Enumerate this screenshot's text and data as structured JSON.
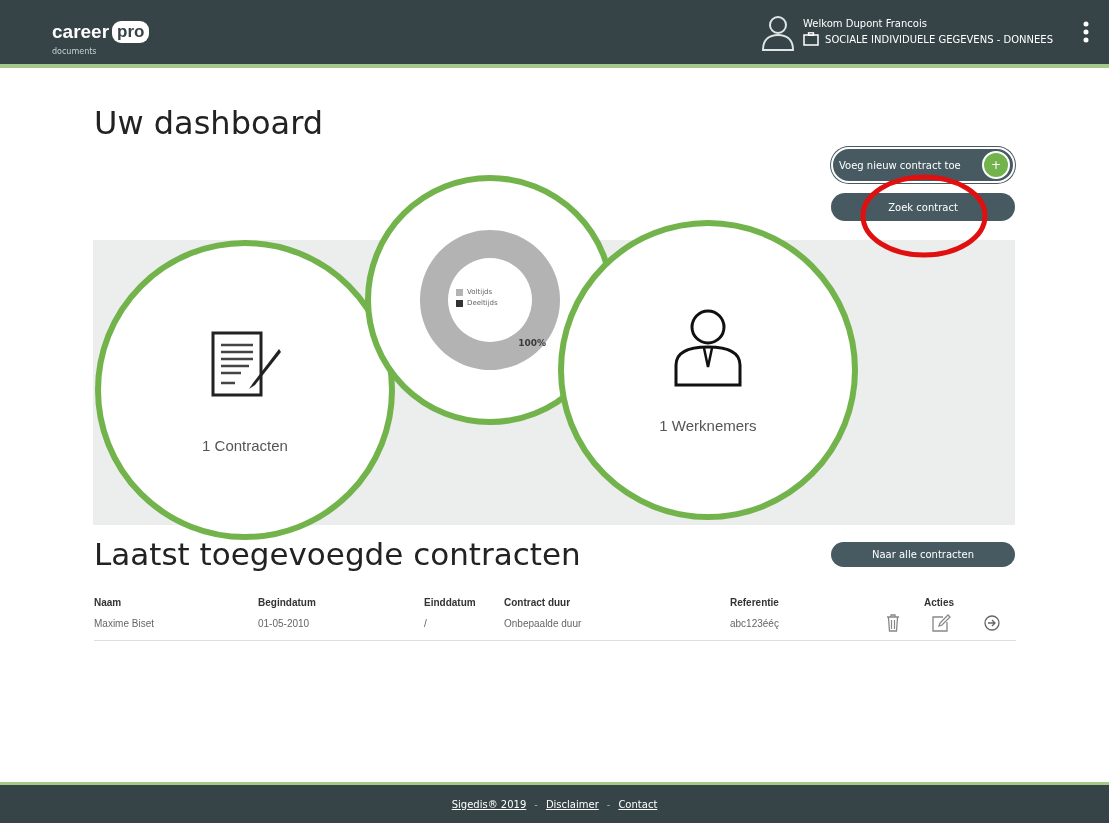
{
  "header": {
    "logo": {
      "word": "career",
      "badge": "pro",
      "subtitle": "documents"
    },
    "welcome": "Welkom Dupont Francois",
    "employer": "SOCIALE INDIVIDUELE GEGEVENS - DONNEES"
  },
  "dashboard": {
    "title": "Uw dashboard",
    "actions": [
      {
        "kind": "add",
        "label": "Voeg nieuw contract toe",
        "icon": "+"
      },
      {
        "kind": "plain",
        "label": "Zoek contract",
        "highlighted": true
      }
    ],
    "contracts": {
      "count": "1",
      "label": "Contracten"
    },
    "chart": {
      "legend": [
        {
          "label": "Voltijds",
          "color": "#b3b3b3"
        },
        {
          "label": "Deeltijds",
          "color": "#333333"
        }
      ],
      "label": "100%"
    },
    "employees": {
      "count": "1",
      "label": "Werknemers"
    }
  },
  "recent": {
    "title": "Laatst toegevoegde contracten",
    "button": "Naar alle contracten",
    "columns": [
      "Naam",
      "Begindatum",
      "Einddatum",
      "Contract duur",
      "Referentie",
      "Acties"
    ],
    "rows": [
      {
        "cells": [
          "Maxime Biset",
          "01-05-2010",
          "/",
          "Onbepaalde duur",
          "abc123ééç"
        ]
      }
    ]
  },
  "footer": {
    "links": [
      "Sigedis® 2019",
      "Disclaimer",
      "Contact"
    ],
    "separator": "-"
  }
}
